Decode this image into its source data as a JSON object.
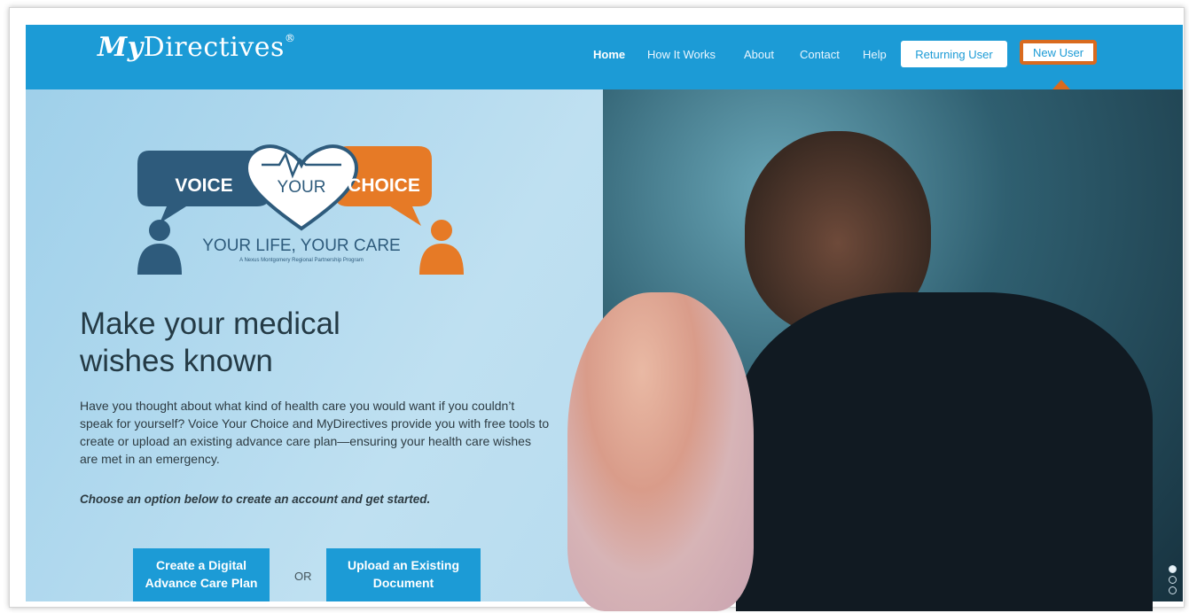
{
  "navbar": {
    "logo": {
      "script": "My",
      "word": "Directives",
      "mark": "®"
    },
    "items": [
      {
        "label": "Home"
      },
      {
        "label": "How It Works"
      },
      {
        "label": "About"
      },
      {
        "label": "Contact"
      },
      {
        "label": "Help"
      }
    ],
    "returning_user_label": "Returning User",
    "new_user_label": "New User"
  },
  "hero": {
    "badge": {
      "left": "VOICE",
      "middle": "YOUR",
      "right": "CHOICE",
      "tagline": "YOUR LIFE, YOUR CARE",
      "subline": "A Nexus Montgomery Regional Partnership Program"
    },
    "headline_line1": "Make your medical",
    "headline_line2": "wishes known",
    "body": "Have you thought about what kind of health care you would want if you couldn’t speak for yourself? Voice Your Choice and MyDirectives provide you with free tools to create or upload an existing advance care plan—ensuring your health care wishes are met in an emergency.",
    "prompt": "Choose an option below to create an account and get started.",
    "cta_create_line1": "Create a Digital",
    "cta_create_line2": "Advance Care Plan",
    "or_label": "OR",
    "cta_upload_line1": "Upload an Existing",
    "cta_upload_line2": "Document"
  },
  "colors": {
    "brand_blue": "#1c9bd6",
    "highlight_orange": "#d96a1e",
    "badge_navy": "#2e5b7c",
    "badge_orange": "#e67a26"
  }
}
